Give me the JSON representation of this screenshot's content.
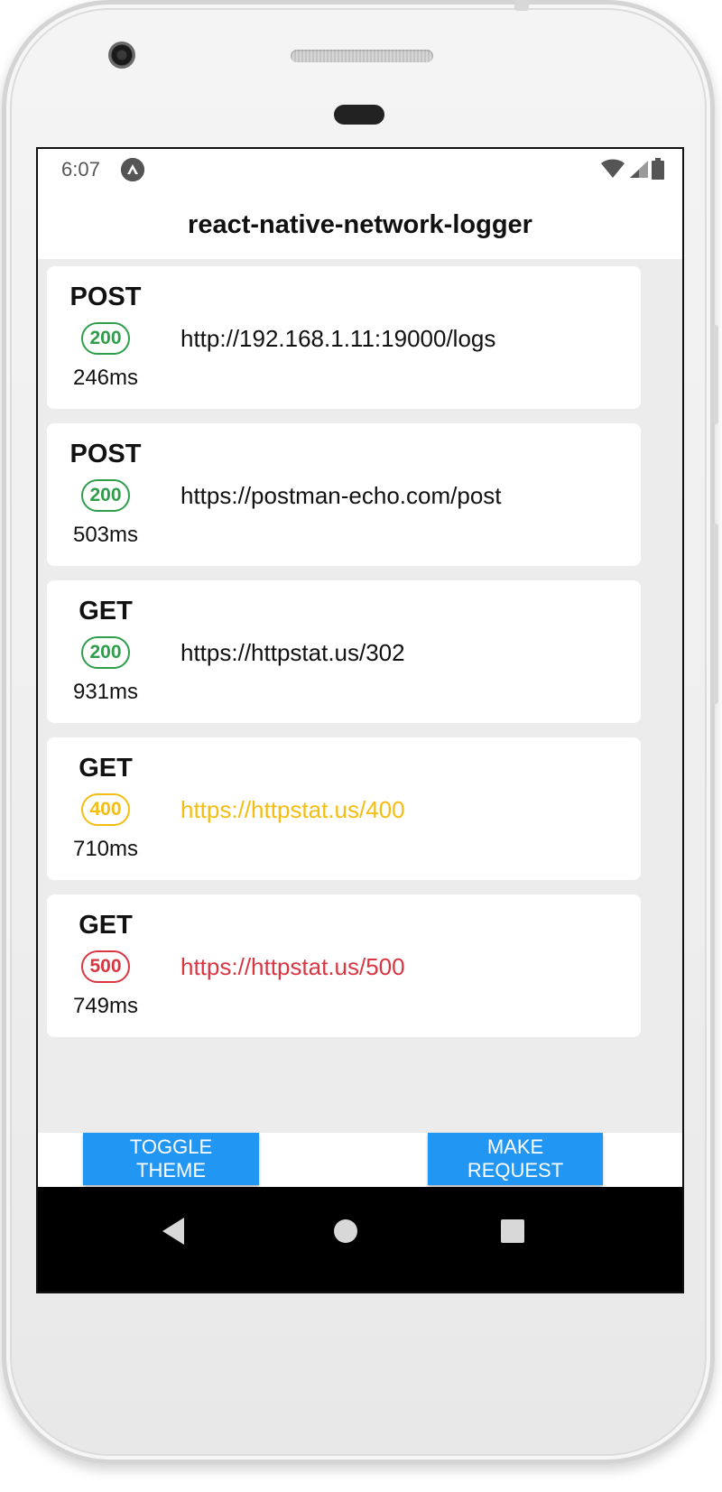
{
  "status_bar": {
    "time": "6:07",
    "app_icon_glyph": "^",
    "icons": [
      "wifi-icon",
      "signal-icon",
      "battery-icon"
    ]
  },
  "header": {
    "title": "react-native-network-logger"
  },
  "requests": [
    {
      "method": "POST",
      "status": "200",
      "status_color": "#2e9e4a",
      "duration": "246ms",
      "url": "http://192.168.1.11:19000/logs",
      "url_color": "#111111"
    },
    {
      "method": "POST",
      "status": "200",
      "status_color": "#2e9e4a",
      "duration": "503ms",
      "url": "https://postman-echo.com/post",
      "url_color": "#111111"
    },
    {
      "method": "GET",
      "status": "200",
      "status_color": "#2e9e4a",
      "duration": "931ms",
      "url": "https://httpstat.us/302",
      "url_color": "#111111"
    },
    {
      "method": "GET",
      "status": "400",
      "status_color": "#f5bd12",
      "duration": "710ms",
      "url": "https://httpstat.us/400",
      "url_color": "#f5bd12"
    },
    {
      "method": "GET",
      "status": "500",
      "status_color": "#d93642",
      "duration": "749ms",
      "url": "https://httpstat.us/500",
      "url_color": "#d93642"
    }
  ],
  "actions": {
    "toggle_theme": "TOGGLE THEME",
    "make_request": "MAKE REQUEST"
  },
  "colors": {
    "accent": "#2196f3",
    "list_background": "#ececec"
  },
  "nav": [
    "back-icon",
    "home-icon",
    "recents-icon"
  ]
}
